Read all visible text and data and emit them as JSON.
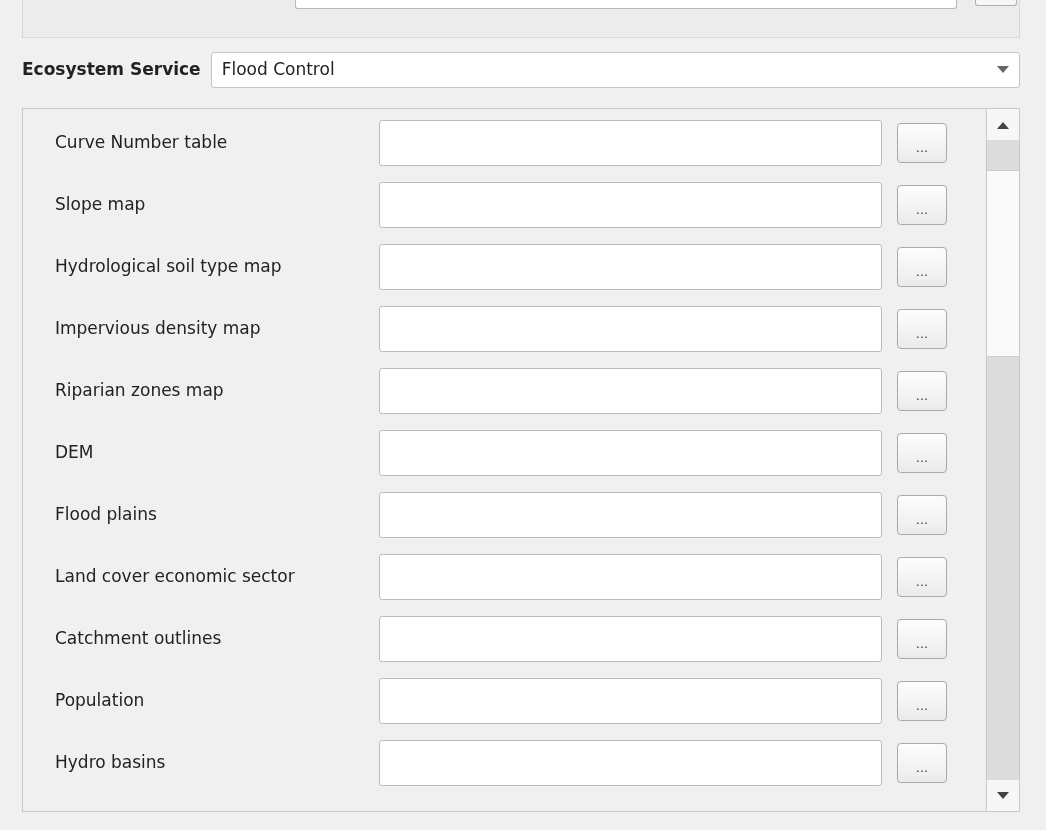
{
  "service": {
    "label": "Ecosystem Service",
    "value": "Flood Control"
  },
  "inputs": [
    {
      "label": "Curve Number table",
      "button": "..."
    },
    {
      "label": "Slope map",
      "button": "..."
    },
    {
      "label": "Hydrological soil type map",
      "button": "..."
    },
    {
      "label": "Impervious density map",
      "button": "..."
    },
    {
      "label": "Riparian zones map",
      "button": "..."
    },
    {
      "label": "DEM",
      "button": "..."
    },
    {
      "label": "Flood plains",
      "button": "..."
    },
    {
      "label": "Land cover economic sector",
      "button": "..."
    },
    {
      "label": "Catchment outlines",
      "button": "..."
    },
    {
      "label": "Population",
      "button": "..."
    },
    {
      "label": "Hydro basins",
      "button": "..."
    }
  ]
}
